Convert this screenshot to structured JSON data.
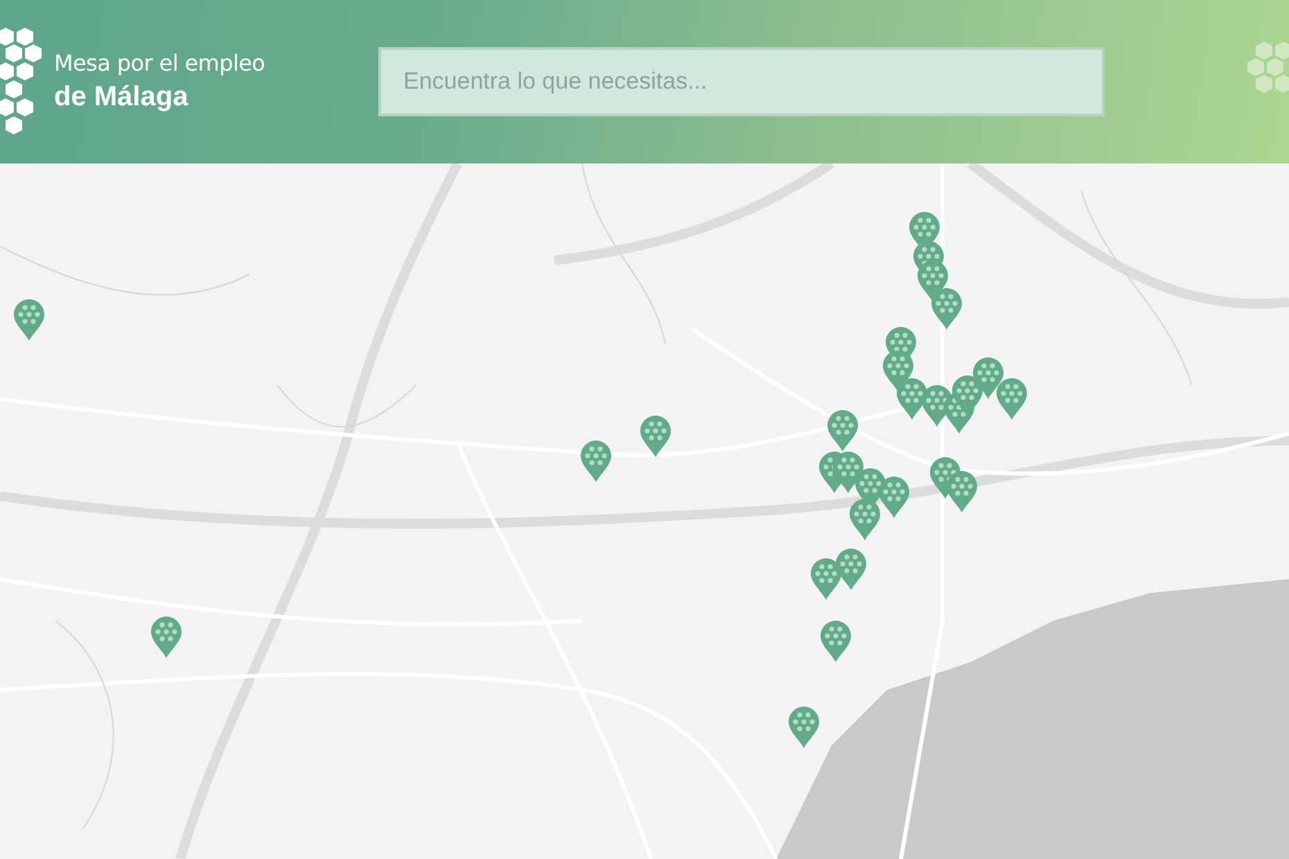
{
  "header": {
    "logo": {
      "line_1": "Mesa por el empleo",
      "line_2": "de Málaga"
    },
    "search": {
      "placeholder": "Encuentra lo que necesitas..."
    }
  }
}
